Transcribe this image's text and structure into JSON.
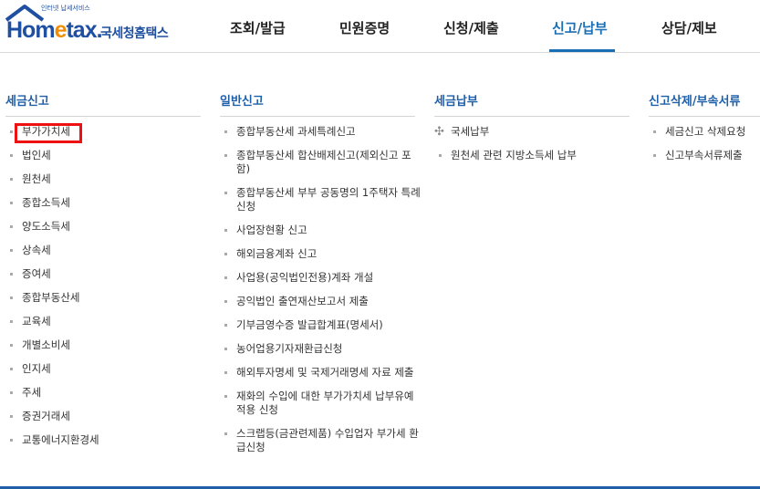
{
  "logo": {
    "word_home": "Hom",
    "word_e": "e",
    "word_tax": "tax.",
    "subtitle": "인터넷 납세서비스",
    "name_kr": "국세청홈택스"
  },
  "nav": [
    {
      "label": "조회/발급"
    },
    {
      "label": "민원증명"
    },
    {
      "label": "신청/제출"
    },
    {
      "label": "신고/납부",
      "active": true
    },
    {
      "label": "상담/제보"
    }
  ],
  "columns": {
    "tax_report": {
      "title": "세금신고",
      "items": [
        "부가가치세",
        "법인세",
        "원천세",
        "종합소득세",
        "양도소득세",
        "상속세",
        "증여세",
        "종합부동산세",
        "교육세",
        "개별소비세",
        "인지세",
        "주세",
        "증권거래세",
        "교통에너지환경세"
      ]
    },
    "general_report": {
      "title": "일반신고",
      "items": [
        "종합부동산세 과세특례신고",
        "종합부동산세 합산배제신고(제외신고 포함)",
        "종합부동산세 부부 공동명의 1주택자 특례 신청",
        "사업장현황 신고",
        "해외금융계좌 신고",
        "사업용(공익법인전용)계좌 개설",
        "공익법인 출연재산보고서 제출",
        "기부금영수증 발급합계표(명세서)",
        "농어업용기자재환급신청",
        "해외투자명세 및 국제거래명세 자료 제출",
        "재화의 수입에 대한 부가가치세 납부유예 적용 신청",
        "스크랩등(금관련제품) 수입업자 부가세 환급신청"
      ]
    },
    "tax_payment": {
      "title": "세금납부",
      "items": [
        "국세납부",
        "원천세 관련 지방소득세 납부"
      ]
    },
    "report_delete": {
      "title": "신고삭제/부속서류",
      "items": [
        "세금신고 삭제요청",
        "신고부속서류제출"
      ]
    }
  },
  "colors": {
    "accent": "#1a6fb4",
    "highlight_border": "#ee1111"
  }
}
